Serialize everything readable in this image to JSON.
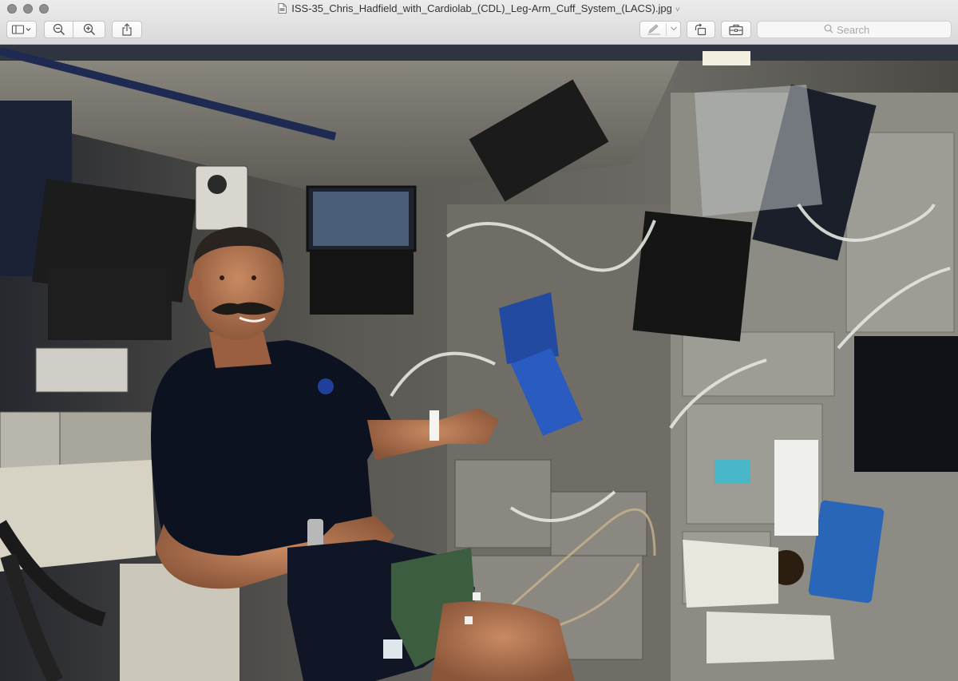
{
  "window": {
    "title": "ISS-35_Chris_Hadfield_with_Cardiolab_(CDL)_Leg-Arm_Cuff_System_(LACS).jpg",
    "title_icon": "jpg-document-icon",
    "title_chevron": "˅"
  },
  "toolbar": {
    "left_buttons": [
      "sidebar-toggle-icon",
      "zoom-out-icon",
      "zoom-in-icon",
      "share-icon"
    ],
    "right_buttons": [
      "markup-pen-icon",
      "rotate-icon",
      "toolbox-icon"
    ]
  },
  "search": {
    "placeholder": "Search"
  },
  "image": {
    "subject": "photo"
  }
}
